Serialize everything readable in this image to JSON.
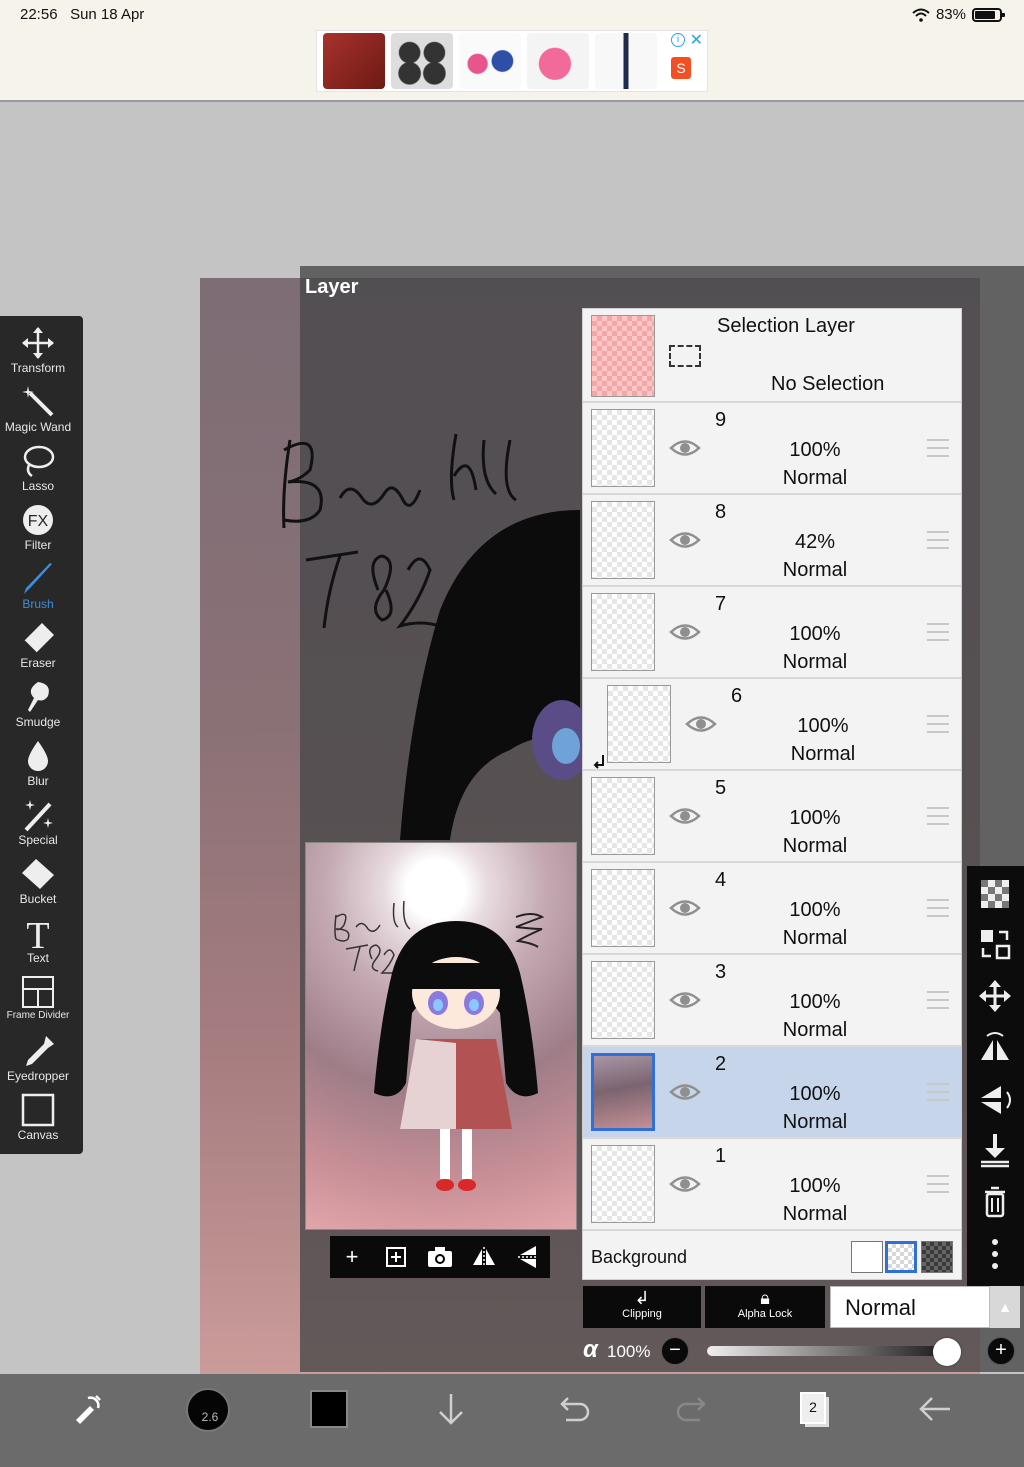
{
  "status_bar": {
    "time": "22:56",
    "date": "Sun 18 Apr",
    "battery": "83%"
  },
  "ad": {
    "shop_icon": "S",
    "info_icon": "i",
    "close_icon": "✕"
  },
  "panel": {
    "title": "Layer"
  },
  "sketch": {
    "text_line1": "Bao ly",
    "text_line2": "782"
  },
  "tools": [
    {
      "label": "Transform",
      "icon": "move-arrows-icon"
    },
    {
      "label": "Magic Wand",
      "icon": "magic-wand-icon"
    },
    {
      "label": "Lasso",
      "icon": "lasso-icon"
    },
    {
      "label": "Filter",
      "icon": "fx-icon"
    },
    {
      "label": "Brush",
      "icon": "brush-icon"
    },
    {
      "label": "Eraser",
      "icon": "eraser-icon"
    },
    {
      "label": "Smudge",
      "icon": "smudge-icon"
    },
    {
      "label": "Blur",
      "icon": "blur-drop-icon"
    },
    {
      "label": "Special",
      "icon": "special-icon"
    },
    {
      "label": "Bucket",
      "icon": "bucket-icon"
    },
    {
      "label": "Text",
      "icon": "text-icon"
    },
    {
      "label": "Frame Divider",
      "icon": "frame-divider-icon"
    },
    {
      "label": "Eyedropper",
      "icon": "eyedropper-icon"
    },
    {
      "label": "Canvas",
      "icon": "canvas-icon"
    }
  ],
  "active_tool": "Brush",
  "selection_layer": {
    "title": "Selection Layer",
    "status": "No Selection"
  },
  "layers": [
    {
      "num": "9",
      "opacity": "100%",
      "mode": "Normal"
    },
    {
      "num": "8",
      "opacity": "42%",
      "mode": "Normal"
    },
    {
      "num": "7",
      "opacity": "100%",
      "mode": "Normal"
    },
    {
      "num": "6",
      "opacity": "100%",
      "mode": "Normal"
    },
    {
      "num": "5",
      "opacity": "100%",
      "mode": "Normal"
    },
    {
      "num": "4",
      "opacity": "100%",
      "mode": "Normal"
    },
    {
      "num": "3",
      "opacity": "100%",
      "mode": "Normal"
    },
    {
      "num": "2",
      "opacity": "100%",
      "mode": "Normal"
    },
    {
      "num": "1",
      "opacity": "100%",
      "mode": "Normal"
    }
  ],
  "selected_layer": "2",
  "clipped_layer": "6",
  "background": {
    "label": "Background"
  },
  "blend": {
    "clipping_label": "Clipping",
    "alpha_lock_label": "Alpha Lock",
    "mode": "Normal",
    "alpha_symbol": "α",
    "opacity": "100%",
    "opacity_fraction": 1.0,
    "minus": "−",
    "plus": "+"
  },
  "bottom_bar": {
    "brush_size": "2.6",
    "pages": "2"
  },
  "colors": {
    "accent": "#2f6fd6",
    "brush_active": "#3d8de0",
    "selected_row": "#c6d5ea"
  }
}
